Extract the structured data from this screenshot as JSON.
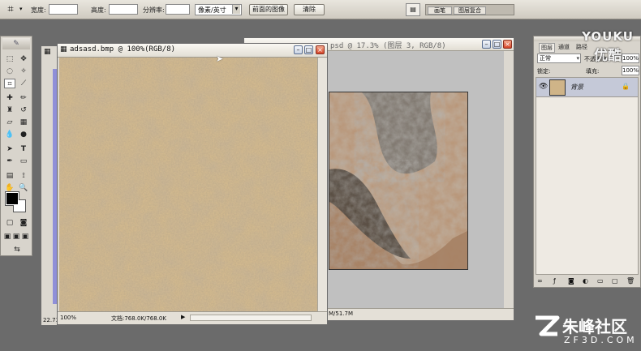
{
  "options_bar": {
    "crop_icon": "crop-icon",
    "width_label": "宽度:",
    "width_value": "",
    "height_label": "高度:",
    "height_value": "",
    "resolution_label": "分辨率:",
    "resolution_value": "",
    "unit_value": "像素/英寸",
    "front_image_button": "前面的图像",
    "clear_button": "清除",
    "palette_tabs": [
      "画笔",
      "图层复合"
    ]
  },
  "toolbox": {
    "tools": [
      "move-icon",
      "marquee-icon",
      "lasso-icon",
      "magic-wand-icon",
      "crop-icon",
      "slice-icon",
      "healing-icon",
      "brush-icon",
      "stamp-icon",
      "history-brush-icon",
      "eraser-icon",
      "gradient-icon",
      "blur-icon",
      "dodge-icon",
      "path-select-icon",
      "type-icon",
      "pen-icon",
      "shape-icon",
      "notes-icon",
      "eyedropper-icon",
      "hand-icon",
      "zoom-icon"
    ]
  },
  "doc_front": {
    "title": "adsasd.bmp @ 100%(RGB/8)",
    "zoom": "100%",
    "doc_size": "文档:768.0K/768.0K"
  },
  "doc_back": {
    "title": "psd @ 17.3% (图层 3, RGB/8)",
    "doc_size": "M/51.7M"
  },
  "doc_partial": {
    "zoom": "22.73"
  },
  "layers_panel": {
    "tabs": [
      "图层",
      "通道",
      "路径"
    ],
    "blend_mode": "正常",
    "opacity_label": "不透明度:",
    "opacity_value": "100%",
    "lock_label": "锁定:",
    "fill_label": "填充:",
    "fill_value": "100%",
    "layer_name": "背景"
  },
  "watermarks": {
    "youku_latin": "YOUKU",
    "youku_cn": "优酷",
    "site_cn": "朱峰社区",
    "site_domain": "ZF3D.COM"
  },
  "colors": {
    "workspace": "#6b6b6b",
    "chrome": "#dcd8d0",
    "sand": "#d2b98e",
    "rock_dark": "#5a4a3c",
    "rock_gray": "#8a8a8a",
    "back_canvas_bg": "#c0c0c0",
    "accent_blue": "#8f8fd8"
  }
}
